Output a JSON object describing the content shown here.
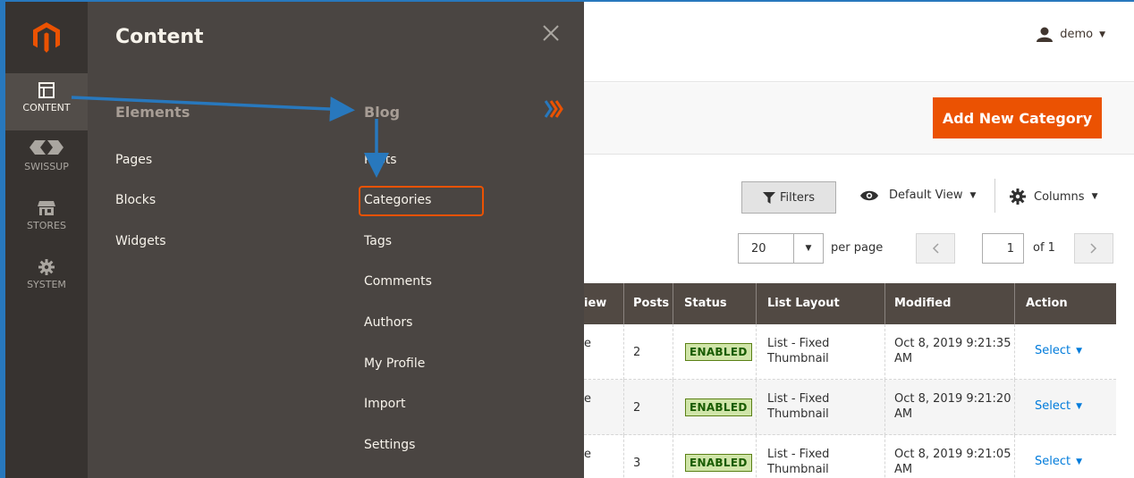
{
  "rail": {
    "items": [
      {
        "label": "CONTENT",
        "icon": "content-icon"
      },
      {
        "label": "SWISSUP",
        "icon": "swissup-icon"
      },
      {
        "label": "STORES",
        "icon": "stores-icon"
      },
      {
        "label": "SYSTEM",
        "icon": "gear-icon"
      }
    ]
  },
  "flyout": {
    "title": "Content",
    "columns": [
      {
        "heading": "Elements",
        "links": [
          "Pages",
          "Blocks",
          "Widgets"
        ]
      },
      {
        "heading": "Blog",
        "links": [
          "Posts",
          "Categories",
          "Tags",
          "Comments",
          "Authors",
          "My Profile",
          "Import",
          "Settings"
        ]
      }
    ],
    "highlighted": "Categories"
  },
  "header": {
    "user": "demo"
  },
  "actions": {
    "add_button": "Add New Category"
  },
  "toolbar": {
    "filters": "Filters",
    "view": "Default View",
    "columns": "Columns",
    "per_page_value": "20",
    "per_page_label": "per page",
    "current_page": "1",
    "of_pages": "of 1"
  },
  "table": {
    "headers": [
      "iew",
      "Posts",
      "Status",
      "List Layout",
      "Modified",
      "Action"
    ],
    "rows": [
      {
        "view": "e",
        "posts": "2",
        "status": "ENABLED",
        "layout_1": "List - Fixed",
        "layout_2": "Thumbnail",
        "modified_1": "Oct 8, 2019 9:21:35",
        "modified_2": "AM",
        "action": "Select"
      },
      {
        "view": "e",
        "posts": "2",
        "status": "ENABLED",
        "layout_1": "List - Fixed",
        "layout_2": "Thumbnail",
        "modified_1": "Oct 8, 2019 9:21:20",
        "modified_2": "AM",
        "action": "Select"
      },
      {
        "view": "e",
        "posts": "3",
        "status": "ENABLED",
        "layout_1": "List - Fixed",
        "layout_2": "Thumbnail",
        "modified_1": "Oct 8, 2019 9:21:05",
        "modified_2": "AM",
        "action": "Select"
      }
    ]
  },
  "colors": {
    "accent": "#eb5202",
    "rail": "#373330",
    "flyout": "#4a4542",
    "arrow": "#2878bd",
    "link": "#007bdb"
  }
}
